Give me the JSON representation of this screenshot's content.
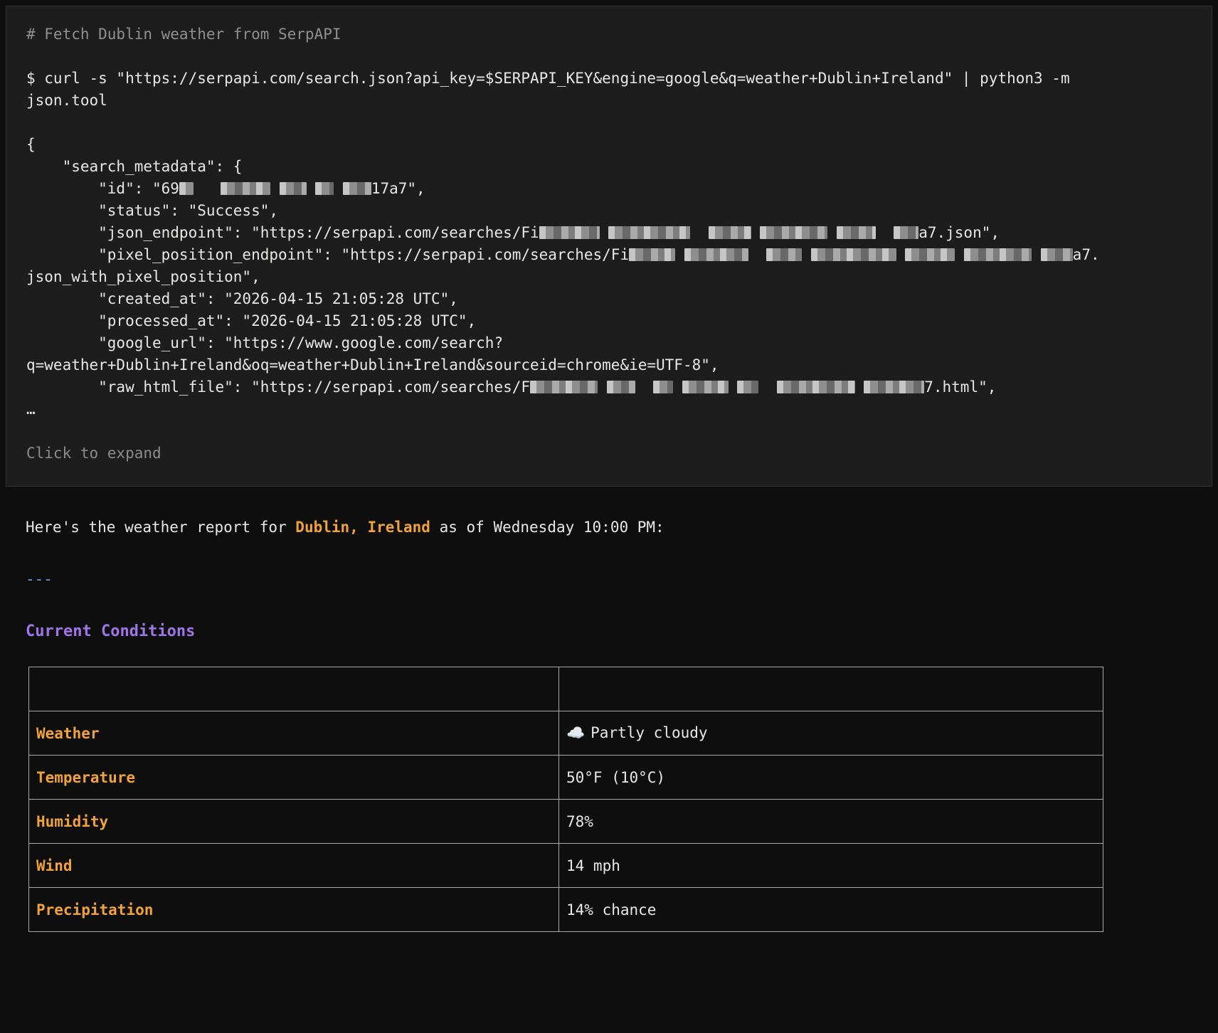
{
  "colors": {
    "accent-orange": "#efa23d",
    "accent-purple": "#9f75e8",
    "accent-blue": "#6a9fd8"
  },
  "terminal": {
    "lines": [
      {
        "seg": [
          {
            "t": "# Fetch Dublin weather from SerpAPI",
            "s": "comment"
          }
        ]
      },
      {
        "seg": []
      },
      {
        "seg": [
          {
            "t": "$ curl -s \"https://serpapi.com/search.json?api_key=$SERPAPI_KEY&engine=google&q=weather+Dublin+Ireland\" | python3 -m"
          }
        ]
      },
      {
        "seg": [
          {
            "t": "json.tool"
          }
        ]
      },
      {
        "seg": []
      },
      {
        "seg": [
          {
            "t": "{"
          }
        ]
      },
      {
        "seg": [
          {
            "t": "    \"search_metadata\": {"
          }
        ]
      },
      {
        "seg": [
          {
            "t": "        \"id\": \"69"
          },
          {
            "r": 20
          },
          {
            "t": "   "
          },
          {
            "r": 70
          },
          {
            "t": " "
          },
          {
            "r": 38
          },
          {
            "t": " "
          },
          {
            "r": 26
          },
          {
            "t": " "
          },
          {
            "r": 40
          },
          {
            "t": "17a7\","
          }
        ]
      },
      {
        "seg": [
          {
            "t": "        \"status\": \"Success\","
          }
        ]
      },
      {
        "seg": [
          {
            "t": "        \"json_endpoint\": \"https://serpapi.com/searches/Fi"
          },
          {
            "r": 85
          },
          {
            "t": " "
          },
          {
            "r": 115
          },
          {
            "t": "  "
          },
          {
            "r": 60
          },
          {
            "t": " "
          },
          {
            "r": 95
          },
          {
            "t": " "
          },
          {
            "r": 55
          },
          {
            "t": "  "
          },
          {
            "r": 35
          },
          {
            "t": "a7.json\","
          }
        ]
      },
      {
        "seg": [
          {
            "t": "        \"pixel_position_endpoint\": \"https://serpapi.com/searches/Fi"
          },
          {
            "r": 65
          },
          {
            "t": " "
          },
          {
            "r": 90
          },
          {
            "t": "  "
          },
          {
            "r": 50
          },
          {
            "t": " "
          },
          {
            "r": 120
          },
          {
            "t": " "
          },
          {
            "r": 70
          },
          {
            "t": " "
          },
          {
            "r": 95
          },
          {
            "t": " "
          },
          {
            "r": 45
          },
          {
            "t": "a7."
          }
        ]
      },
      {
        "seg": [
          {
            "t": "json_with_pixel_position\","
          }
        ]
      },
      {
        "seg": [
          {
            "t": "        \"created_at\": \"2026-04-15 21:05:28 UTC\","
          }
        ]
      },
      {
        "seg": [
          {
            "t": "        \"processed_at\": \"2026-04-15 21:05:28 UTC\","
          }
        ]
      },
      {
        "seg": [
          {
            "t": "        \"google_url\": \"https://www.google.com/search?"
          }
        ]
      },
      {
        "seg": [
          {
            "t": "q=weather+Dublin+Ireland&oq=weather+Dublin+Ireland&sourceid=chrome&ie=UTF-8\","
          }
        ]
      },
      {
        "seg": [
          {
            "t": "        \"raw_html_file\": \"https://serpapi.com/searches/F"
          },
          {
            "r": 95
          },
          {
            "t": " "
          },
          {
            "r": 40
          },
          {
            "t": "  "
          },
          {
            "r": 28
          },
          {
            "t": " "
          },
          {
            "r": 65
          },
          {
            "t": " "
          },
          {
            "r": 30
          },
          {
            "t": "  "
          },
          {
            "r": 110
          },
          {
            "t": " "
          },
          {
            "r": 85
          },
          {
            "t": "7.html\","
          }
        ]
      },
      {
        "seg": [
          {
            "t": "…"
          }
        ]
      }
    ],
    "expand_hint": "Click to expand"
  },
  "report": {
    "intro_prefix": "Here's the weather report for ",
    "location": "Dublin, Ireland",
    "intro_suffix": " as of Wednesday 10:00 PM:",
    "divider": "---",
    "section_title": "Current Conditions",
    "table": {
      "headers": [
        "",
        ""
      ],
      "rows": [
        {
          "label": "Weather",
          "icon": "☁️",
          "value": "Partly cloudy"
        },
        {
          "label": "Temperature",
          "value": "50°F (10°C)"
        },
        {
          "label": "Humidity",
          "value": "78%"
        },
        {
          "label": "Wind",
          "value": "14 mph"
        },
        {
          "label": "Precipitation",
          "value": "14% chance"
        }
      ]
    }
  }
}
